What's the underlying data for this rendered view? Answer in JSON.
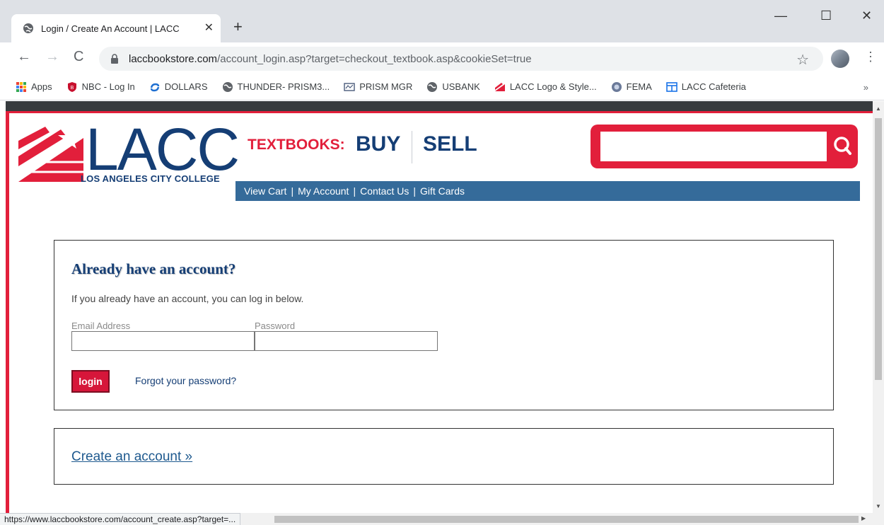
{
  "browser": {
    "tab_title": "Login / Create An Account | LACC",
    "tab_close": "✕",
    "new_tab": "+",
    "window_controls": {
      "minimize": "—",
      "maximize": "☐",
      "close": "✕"
    },
    "url_host": "laccbookstore.com",
    "url_path": "/account_login.asp?target=checkout_textbook.asp&cookieSet=true",
    "bookmarks": [
      {
        "label": "Apps",
        "icon": "apps-grid-icon"
      },
      {
        "label": "NBC - Log In",
        "icon": "nbc-shield-icon"
      },
      {
        "label": "DOLLARS",
        "icon": "dollars-icon"
      },
      {
        "label": "THUNDER- PRISM3...",
        "icon": "globe-icon"
      },
      {
        "label": "PRISM MGR",
        "icon": "prism-icon"
      },
      {
        "label": "USBANK",
        "icon": "globe-icon"
      },
      {
        "label": "LACC Logo & Style...",
        "icon": "lacc-icon"
      },
      {
        "label": "FEMA",
        "icon": "fema-seal-icon"
      },
      {
        "label": "LACC Cafeteria",
        "icon": "cafeteria-icon"
      }
    ],
    "bookmarks_more": "»",
    "status_url": "https://www.laccbookstore.com/account_create.asp?target=..."
  },
  "site": {
    "logo_text": "LACC",
    "logo_caption": "LOS ANGELES CITY COLLEGE",
    "textbooks_label": "TEXTBOOKS:",
    "buy_label": "BUY",
    "sell_label": "SELL",
    "search_value": "",
    "nav": [
      "View Cart",
      "My Account",
      "Contact Us",
      "Gift Cards"
    ]
  },
  "login": {
    "heading": "Already have an account?",
    "intro": "If you already have an account, you can log in below.",
    "email_label": "Email Address",
    "password_label": "Password",
    "email_value": "",
    "password_value": "",
    "login_button": "login",
    "forgot_link": "Forgot your password?"
  },
  "create": {
    "link": "Create an account »"
  },
  "colors": {
    "brand_red": "#e21f3b",
    "brand_blue": "#153e75",
    "nav_blue": "#356b9a"
  }
}
